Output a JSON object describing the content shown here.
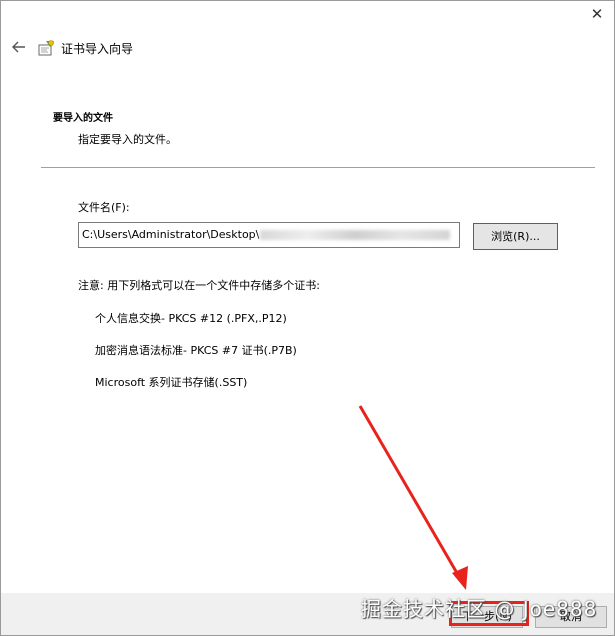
{
  "window": {
    "title": "证书导入向导",
    "close_glyph": "✕"
  },
  "section": {
    "heading": "要导入的文件",
    "description": "指定要导入的文件。"
  },
  "file": {
    "label": "文件名(F):",
    "value": "C:\\Users\\Administrator\\Desktop\\",
    "browse_label": "浏览(R)..."
  },
  "note": "注意: 用下列格式可以在一个文件中存储多个证书:",
  "formats": [
    "个人信息交换- PKCS #12 (.PFX,.P12)",
    "加密消息语法标准- PKCS #7 证书(.P7B)",
    "Microsoft 系列证书存储(.SST)"
  ],
  "footer": {
    "next_label": "下一步(N)",
    "cancel_label": "取消"
  },
  "watermark": "掘金技术社区 @ Joe888",
  "annotation": {
    "color": "#e8231b"
  },
  "icons": [
    "back-arrow-icon",
    "certificate-wizard-icon",
    "close-icon"
  ]
}
